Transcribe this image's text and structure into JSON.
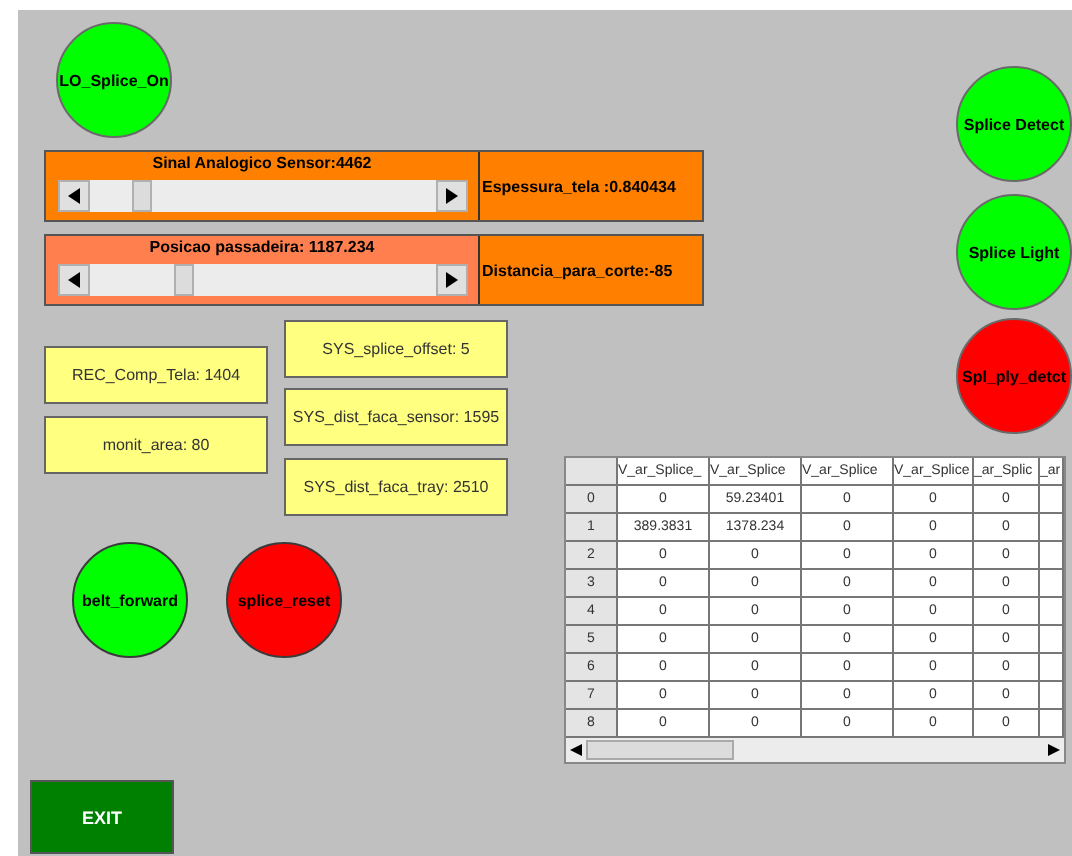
{
  "lamps": [
    {
      "kind": "lamp",
      "label": "LO_Splice_On",
      "color": "#00ff00"
    },
    {
      "kind": "lamp",
      "label": "Splice Detect",
      "color": "#00ff00"
    },
    {
      "kind": "lamp",
      "label": "Splice Light",
      "color": "#00ff00"
    },
    {
      "kind": "lamp",
      "label": "Spl_ply_detct",
      "color": "#ff0000"
    },
    {
      "kind": "button",
      "label": "belt_forward",
      "color": "#00ff00"
    },
    {
      "kind": "button",
      "label": "splice_reset",
      "color": "#ff0000"
    }
  ],
  "sliders": [
    {
      "label": "Sinal Analogico Sensor:4462",
      "level": 0.13,
      "color": "#ff8000",
      "reading": "Espessura_tela :0.840434"
    },
    {
      "label": "Posicao passadeira: 1187.234",
      "level": 0.26,
      "color": "#ff7f4f",
      "reading": "Distancia_para_corte:-85"
    }
  ],
  "value_boxes": [
    "SYS_splice_offset: 5",
    "REC_Comp_Tela: 1404",
    "SYS_dist_faca_sensor: 1595",
    "monit_area: 80",
    "SYS_dist_faca_tray: 2510"
  ],
  "table": {
    "columns": [
      "V_ar_Splice_",
      "V_ar_Splice",
      "V_ar_Splice",
      "V_ar_Splice",
      "_ar_Splic",
      "_ar"
    ],
    "rows": [
      {
        "header": "0",
        "cells": [
          "0",
          "59.23401",
          "0",
          "0",
          "0"
        ]
      },
      {
        "header": "1",
        "cells": [
          "389.3831",
          "1378.234",
          "0",
          "0",
          "0"
        ]
      },
      {
        "header": "2",
        "cells": [
          "0",
          "0",
          "0",
          "0",
          "0"
        ]
      },
      {
        "header": "3",
        "cells": [
          "0",
          "0",
          "0",
          "0",
          "0"
        ]
      },
      {
        "header": "4",
        "cells": [
          "0",
          "0",
          "0",
          "0",
          "0"
        ]
      },
      {
        "header": "5",
        "cells": [
          "0",
          "0",
          "0",
          "0",
          "0"
        ]
      },
      {
        "header": "6",
        "cells": [
          "0",
          "0",
          "0",
          "0",
          "0"
        ]
      },
      {
        "header": "7",
        "cells": [
          "0",
          "0",
          "0",
          "0",
          "0"
        ]
      },
      {
        "header": "8",
        "cells": [
          "0",
          "0",
          "0",
          "0",
          "0"
        ]
      }
    ]
  },
  "exit_button": {
    "label": "EXIT"
  }
}
